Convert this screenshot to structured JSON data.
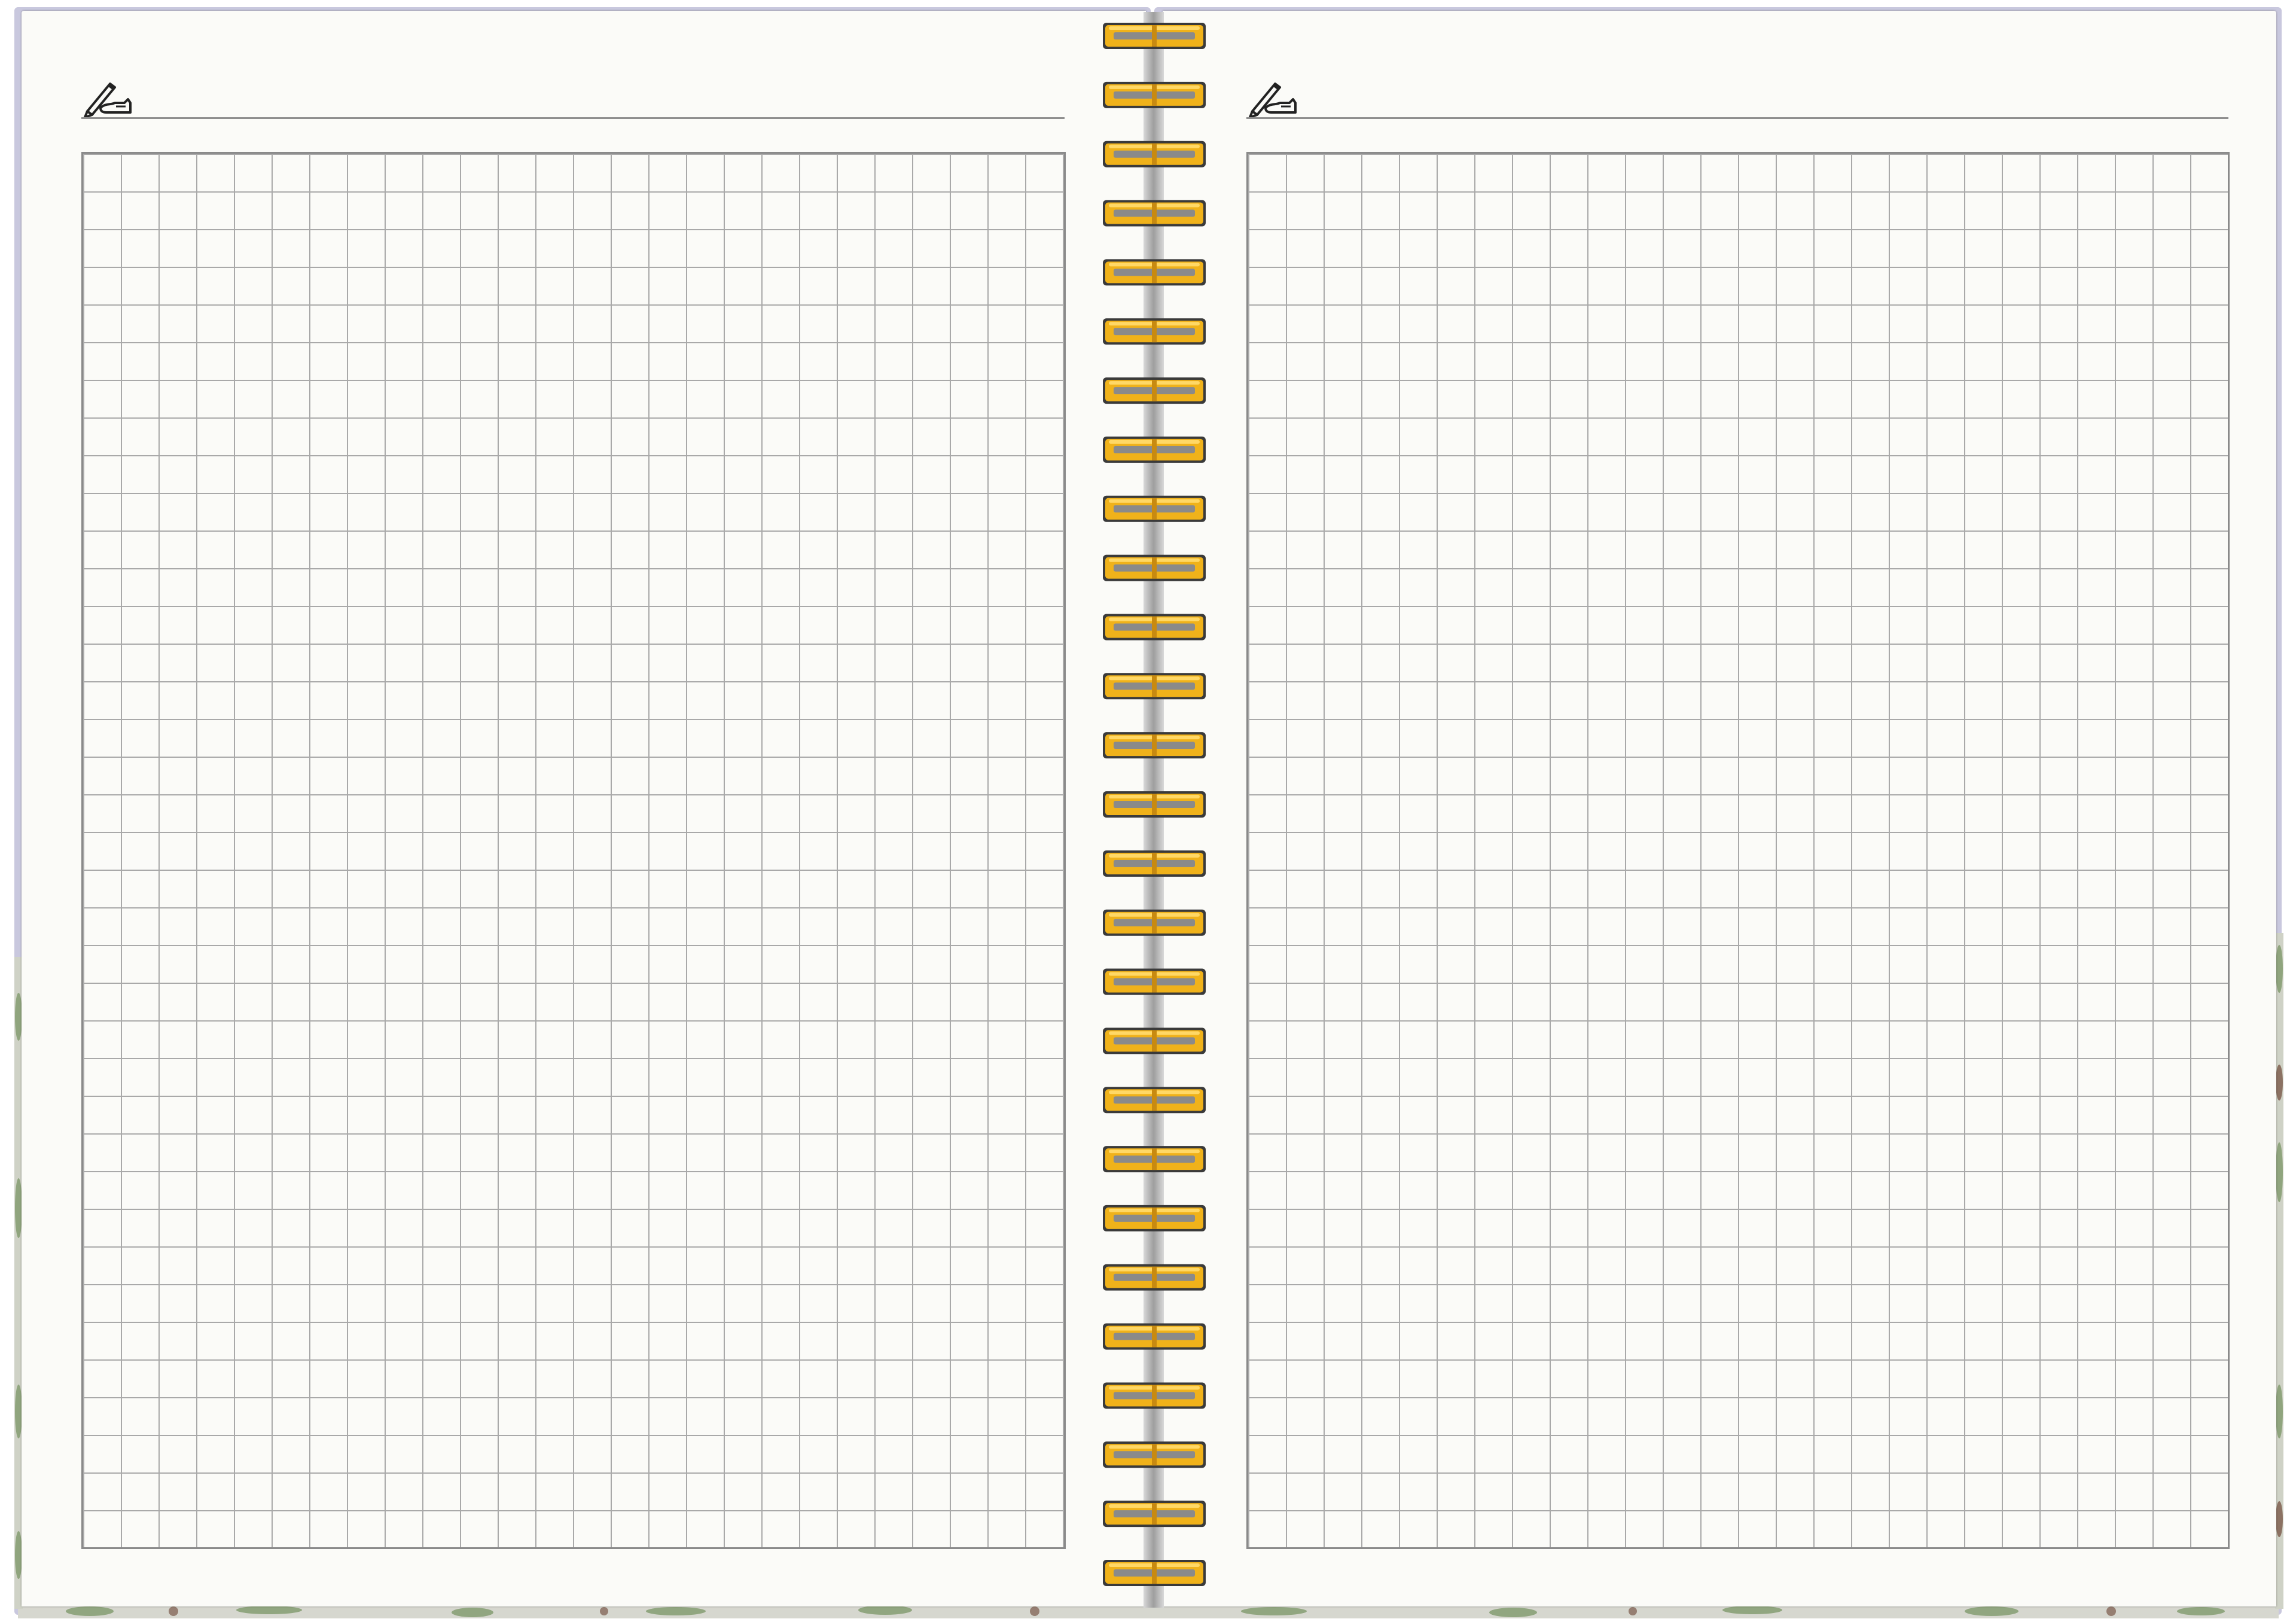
{
  "notebook": {
    "ring_count": 27,
    "colors": {
      "cover": "#c9c8de",
      "page": "#fbfbf8",
      "grid_line": "#a9a9a9",
      "ring_gold": "#f0b21a",
      "ring_dark": "#3a3a3a"
    },
    "left_page": {
      "icon": "pen-writing-icon"
    },
    "right_page": {
      "icon": "pen-writing-icon"
    }
  }
}
